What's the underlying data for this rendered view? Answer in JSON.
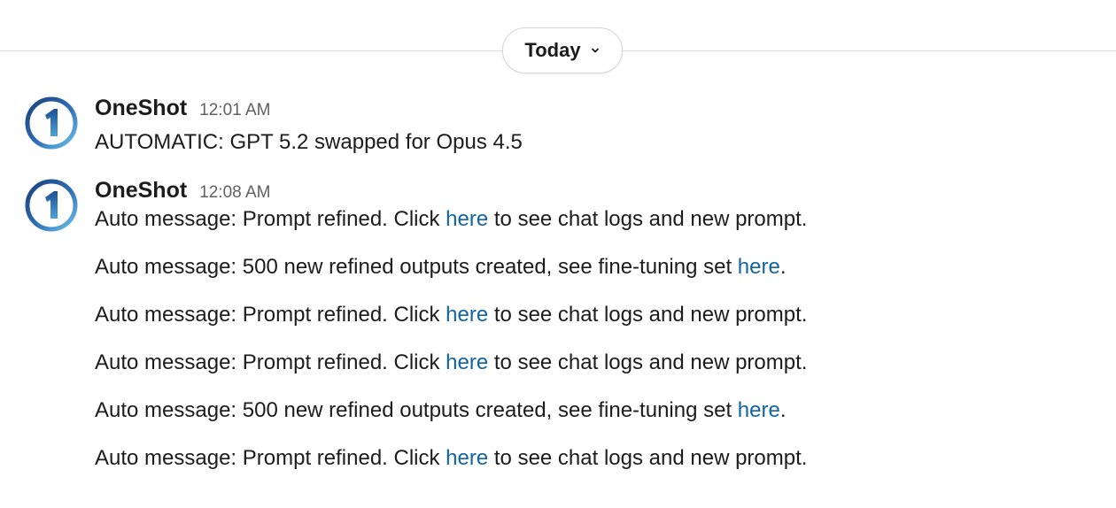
{
  "date_divider": {
    "label": "Today"
  },
  "messages": [
    {
      "sender": "OneShot",
      "time": "12:01 AM",
      "lines": [
        {
          "text": "AUTOMATIC: GPT 5.2 swapped for Opus 4.5"
        }
      ]
    },
    {
      "sender": "OneShot",
      "time": "12:08 AM",
      "lines": [
        {
          "before": "Auto message: Prompt refined. Click ",
          "link": "here",
          "after": " to see chat logs and new prompt."
        },
        {
          "before": "Auto message: 500 new refined outputs created, see fine-tuning set ",
          "link": "here",
          "after": "."
        },
        {
          "before": "Auto message: Prompt refined. Click ",
          "link": "here",
          "after": " to see chat logs and new prompt."
        },
        {
          "before": "Auto message: Prompt refined. Click ",
          "link": "here",
          "after": " to see chat logs and new prompt."
        },
        {
          "before": "Auto message: 500 new refined outputs created, see fine-tuning set ",
          "link": "here",
          "after": "."
        },
        {
          "before": "Auto message: Prompt refined. Click ",
          "link": "here",
          "after": " to see chat logs and new prompt."
        }
      ]
    }
  ],
  "colors": {
    "link": "#1264a3",
    "avatar_ring": "#1f4f8f",
    "avatar_glyph": "#2f7cc1"
  },
  "icons": {
    "avatar": "oneshot-logo-icon",
    "date_toggle": "chevron-down-icon"
  }
}
